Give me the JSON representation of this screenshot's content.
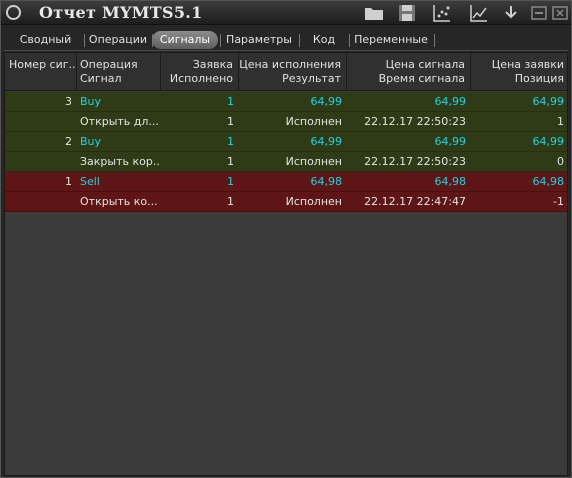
{
  "window": {
    "title": "Отчет MYMTS5.1"
  },
  "toolbar": {
    "icons": [
      "folder-icon",
      "save-icon",
      "scatter-chart-icon",
      "line-chart-icon",
      "download-arrow-icon",
      "minimize-icon",
      "close-icon"
    ]
  },
  "tabs": [
    {
      "label": "Сводный",
      "active": false
    },
    {
      "label": "Операции",
      "active": false
    },
    {
      "label": "Сигналы",
      "active": true
    },
    {
      "label": "Параметры",
      "active": false
    },
    {
      "label": "Код",
      "active": false
    },
    {
      "label": "Переменные",
      "active": false
    }
  ],
  "columns": [
    {
      "l1": "Номер сиг...",
      "l2": ""
    },
    {
      "l1": "Операция",
      "l2": "Сигнал"
    },
    {
      "l1": "Заявка",
      "l2": "Исполнено"
    },
    {
      "l1": "Цена исполнения",
      "l2": "Результат"
    },
    {
      "l1": "Цена сигнала",
      "l2": "Время сигнала"
    },
    {
      "l1": "Цена заявки",
      "l2": "Позиция"
    }
  ],
  "rows": [
    {
      "num": "3",
      "op": "Buy",
      "order": "1",
      "exec_price": "64,99",
      "sig_price": "64,99",
      "order_price": "64,99"
    },
    {
      "num": "",
      "op": "Открыть дл...",
      "order": "1",
      "exec_price": "Исполнен",
      "sig_price": "22.12.17 22:50:23",
      "order_price": "1"
    },
    {
      "num": "2",
      "op": "Buy",
      "order": "1",
      "exec_price": "64,99",
      "sig_price": "64,99",
      "order_price": "64,99"
    },
    {
      "num": "",
      "op": "Закрыть кор...",
      "order": "1",
      "exec_price": "Исполнен",
      "sig_price": "22.12.17 22:50:23",
      "order_price": "0"
    },
    {
      "num": "1",
      "op": "Sell",
      "order": "1",
      "exec_price": "64,98",
      "sig_price": "64,98",
      "order_price": "64,98"
    },
    {
      "num": "",
      "op": "Открыть ко...",
      "order": "1",
      "exec_price": "Исполнен",
      "sig_price": "22.12.17 22:47:47",
      "order_price": "-1"
    }
  ],
  "colors": {
    "buy_row": "#2f3b17",
    "sell_row": "#5d1515",
    "value_cyan": "#19d6e6"
  }
}
